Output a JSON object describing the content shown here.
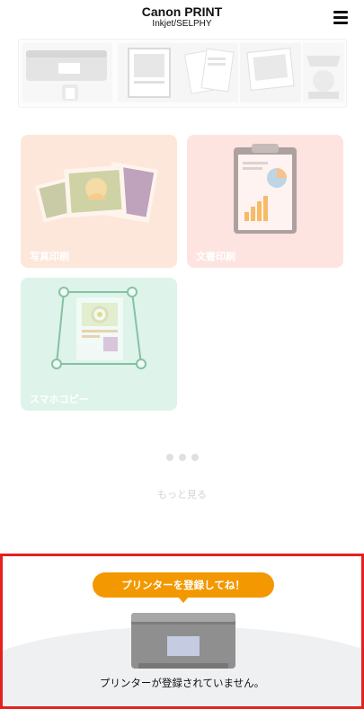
{
  "header": {
    "title": "Canon PRINT",
    "subtitle": "Inkjet/SELPHY",
    "menu_icon": "hamburger-menu-icon"
  },
  "banner": {
    "panels": [
      "printer",
      "photo-frame",
      "documents",
      "photo-print",
      "banner-card"
    ]
  },
  "tiles": [
    {
      "label": "写真印刷",
      "icon": "photo-stack-icon",
      "bg": "#fde7da"
    },
    {
      "label": "文書印刷",
      "icon": "clipboard-document-icon",
      "bg": "#fde4e0"
    },
    {
      "label": "スマホコピー",
      "icon": "scan-document-icon",
      "bg": "#def3ea"
    }
  ],
  "pager": {
    "count": 3
  },
  "more_label": "もっと見る",
  "registration": {
    "bubble_text": "プリンターを登録してね！",
    "message": "プリンターが登録されていません。",
    "accent": "#f39800",
    "highlight_border": "#e5211d"
  }
}
